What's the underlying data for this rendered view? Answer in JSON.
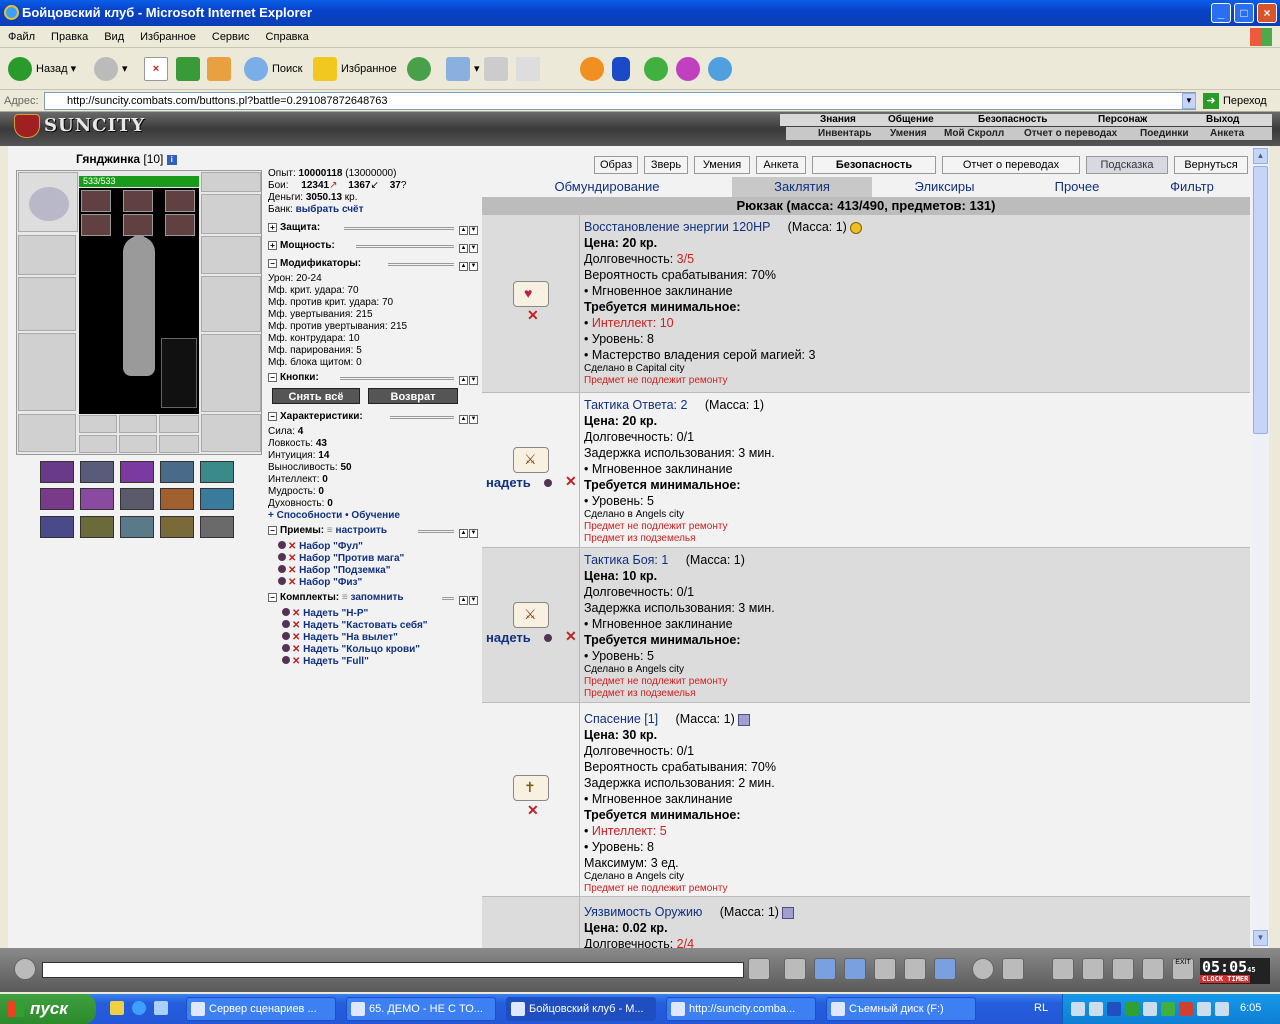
{
  "window": {
    "title": "Бойцовский клуб - Microsoft Internet Explorer"
  },
  "menu": [
    "Файл",
    "Правка",
    "Вид",
    "Избранное",
    "Сервис",
    "Справка"
  ],
  "toolbar": {
    "back": "Назад",
    "search": "Поиск",
    "favorites": "Избранное"
  },
  "address": {
    "label": "Адрес:",
    "url": "http://suncity.combats.com/buttons.pl?battle=0.291087872648763",
    "go": "Переход"
  },
  "game": {
    "logo": "SUNCITY",
    "nav1": [
      "Знания",
      "Общение",
      "Безопасность",
      "Персонаж",
      "Выход"
    ],
    "nav2": [
      "Инвентарь",
      "Умения",
      "Мой Скролл",
      "Отчет о переводах",
      "Поединки",
      "Анкета"
    ]
  },
  "character": {
    "name": "Гянджинка",
    "level": "[10]",
    "hp": "533/533",
    "exp_label": "Опыт:",
    "exp": "10000118",
    "exp_next": "(13000000)",
    "fights_label": "Бои:",
    "wins": "12341",
    "losses": "1367",
    "draws": "37",
    "money_label": "Деньги:",
    "money": "3050.13",
    "money_unit": "кр.",
    "bank_label": "Банк:",
    "bank_link": "выбрать счёт",
    "sections": {
      "protection": "Защита:",
      "power": "Мощность:",
      "modifiers": "Модификаторы:",
      "buttons": "Кнопки:",
      "characteristics": "Характеристики:",
      "tricks": "Приемы:",
      "sets": "Комплекты:"
    },
    "modifiers": [
      "Урон: 20-24",
      "Мф. крит. удара: 70",
      "Мф. против крит. удара: 70",
      "Мф. увертывания: 215",
      "Мф. против увертывания: 215",
      "Мф. контрудара: 10",
      "Мф. парирования: 5",
      "Мф. блока щитом: 0"
    ],
    "btn_remove_all": "Снять всё",
    "btn_return": "Возврат",
    "stats": [
      {
        "k": "Сила:",
        "v": "4"
      },
      {
        "k": "Ловкость:",
        "v": "43"
      },
      {
        "k": "Интуиция:",
        "v": "14"
      },
      {
        "k": "Выносливость:",
        "v": "50"
      },
      {
        "k": "Интеллект:",
        "v": "0"
      },
      {
        "k": "Мудрость:",
        "v": "0"
      },
      {
        "k": "Духовность:",
        "v": "0"
      }
    ],
    "abilities_link": "Способности",
    "training_link": "Обучение",
    "tricks_setup": "настроить",
    "tricks": [
      "Набор \"Фул\"",
      "Набор \"Против мага\"",
      "Набор \"Подземка\"",
      "Набор \"Физ\""
    ],
    "sets_remember": "запомнить",
    "sets": [
      "Надеть \"Н-Р\"",
      "Надеть \"Кастовать себя\"",
      "Надеть \"На вылет\"",
      "Надеть \"Кольцо крови\"",
      "Надеть \"Full\""
    ]
  },
  "tabs": [
    "Образ",
    "Зверь",
    "Умения",
    "Анкета",
    "Безопасность",
    "Отчет о переводах",
    "Подсказка",
    "Вернуться"
  ],
  "categories": [
    "Обмундирование",
    "Заклятия",
    "Эликсиры",
    "Прочее",
    "Фильтр"
  ],
  "backpack": "Рюкзак (масса: 413/490, предметов: 131)",
  "don_label": "надеть",
  "items": [
    {
      "name": "Восстановление энергии 120HP",
      "mass": "(Масса: 1)",
      "price": "Цена: 20 кр.",
      "dur_label": "Долговечность: ",
      "dur": "3/5",
      "lines": [
        "Вероятность срабатывания: 70%",
        "• Мгновенное заклинание"
      ],
      "req": "Требуется минимальное:",
      "req_red": "Интеллект: 10",
      "req_lines": [
        "• Уровень: 8",
        "• Мастерство владения серой магией: 3"
      ],
      "made": "Сделано в Capital city",
      "notes": [
        "Предмет не подлежит ремонту"
      ]
    },
    {
      "name": "Тактика Ответа: 2",
      "mass": "(Масса: 1)",
      "price": "Цена: 20 кр.",
      "dur_label": "Долговечность: ",
      "dur": "0/1",
      "lines": [
        "Задержка использования: 3 мин.",
        "• Мгновенное заклинание"
      ],
      "req": "Требуется минимальное:",
      "req_lines": [
        "• Уровень: 5"
      ],
      "made": "Сделано в Angels city",
      "notes": [
        "Предмет не подлежит ремонту",
        "Предмет из подземелья"
      ]
    },
    {
      "name": "Тактика Боя: 1",
      "mass": "(Масса: 1)",
      "price": "Цена: 10 кр.",
      "dur_label": "Долговечность: ",
      "dur": "0/1",
      "lines": [
        "Задержка использования: 3 мин.",
        "• Мгновенное заклинание"
      ],
      "req": "Требуется минимальное:",
      "req_lines": [
        "• Уровень: 5"
      ],
      "made": "Сделано в Angels city",
      "notes": [
        "Предмет не подлежит ремонту",
        "Предмет из подземелья"
      ]
    },
    {
      "name": "Спасение [1]",
      "mass": "(Масса: 1)",
      "price": "Цена: 30 кр.",
      "dur_label": "Долговечность: ",
      "dur": "0/1",
      "lines": [
        "Вероятность срабатывания: 70%",
        "Задержка использования: 2 мин.",
        "• Мгновенное заклинание"
      ],
      "req": "Требуется минимальное:",
      "req_red": "Интеллект: 5",
      "req_lines": [
        "• Уровень: 8",
        "Максимум: 3 ед."
      ],
      "made": "Сделано в Angels city",
      "notes": [
        "Предмет не подлежит ремонту"
      ]
    },
    {
      "name": "Уязвимость Оружию",
      "mass": "(Масса: 1)",
      "price": "Цена: 0.02 кр.",
      "dur_label": "Долговечность: ",
      "dur": "2/4"
    }
  ],
  "clock": {
    "time": "05:05",
    "sec": "45",
    "label": "CLOCK TIMER"
  },
  "taskbar": {
    "start": "пуск",
    "tasks": [
      "Сервер сценариев ...",
      "65. ДЕМО - НЕ С ТО...",
      "Бойцовский клуб - M...",
      "http://suncity.comba...",
      "Съемный диск (F:)"
    ],
    "lang": "RL",
    "time": "6:05"
  }
}
